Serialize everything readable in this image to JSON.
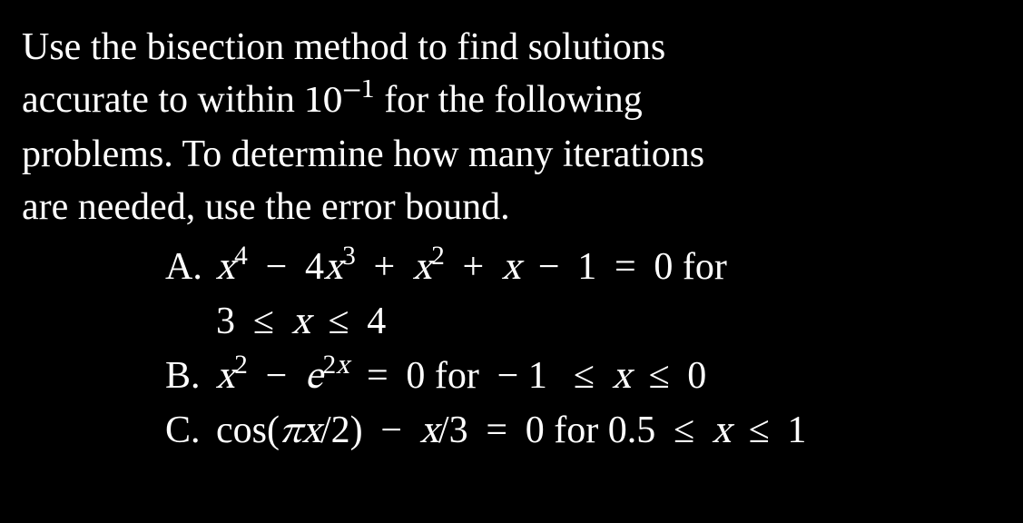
{
  "intro": {
    "line1": "Use the bisection method to find solutions",
    "line2a": "accurate to within ",
    "tol_base": "10",
    "tol_exp": "−1",
    "line2b": " for the following",
    "line3": "problems. To determine how many iterations",
    "line4": "are needed, use the error bound."
  },
  "items": {
    "a": {
      "letter": "A.",
      "eq_part1": "x",
      "exp1": "4",
      "minus1": " − ",
      "coef1": "4",
      "var2": "x",
      "exp2": "3",
      "plus1": " + ",
      "var3": "x",
      "exp3": "2",
      "plus2": " + ",
      "var4": "x",
      "minus2": " − ",
      "one": "1",
      "eq": " = ",
      "zero": "0",
      "for": " for",
      "range_lo": "3",
      "leq1": " ≤ ",
      "rvar": "x",
      "leq2": " ≤ ",
      "range_hi": "4"
    },
    "b": {
      "letter": "B.",
      "var1": "x",
      "exp1": "2",
      "minus": " − ",
      "ebase": "e",
      "eexp_coef": "2",
      "eexp_var": "x",
      "eq": " = ",
      "zero": "0",
      "for": " for ",
      "range_lo": " − 1",
      "leq1": " ≤ ",
      "rvar": "x",
      "leq2": " ≤ ",
      "range_hi": "0"
    },
    "c": {
      "letter": "C.",
      "cos": "cos",
      "lparen": "(",
      "pi": "π",
      "var1": "x",
      "slash1": "/",
      "two": "2",
      "rparen": ")",
      "minus": " − ",
      "var2": "x",
      "slash2": "/",
      "three": "3",
      "eq": " = ",
      "zero": "0",
      "for": " for ",
      "range_lo": "0.5",
      "leq1": " ≤ ",
      "rvar": "x",
      "leq2": " ≤ ",
      "range_hi": "1"
    }
  }
}
